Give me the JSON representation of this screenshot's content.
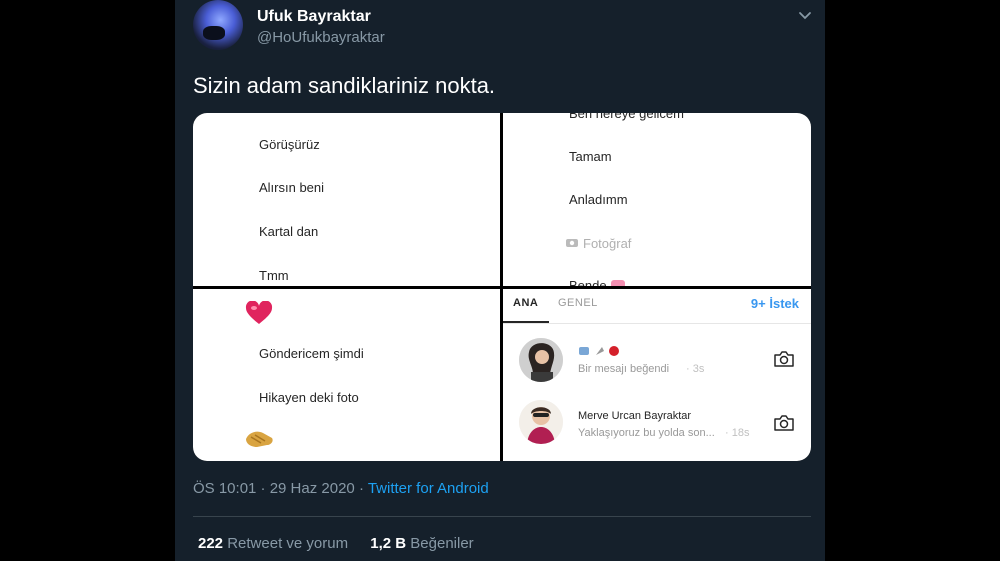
{
  "author": {
    "name": "Ufuk Bayraktar",
    "handle": "@HoUfukbayraktar"
  },
  "tweet": {
    "text": "Sizin adam sandiklariniz nokta."
  },
  "chat_left_top": {
    "messages": [
      "Görüşürüz",
      "Alırsın beni",
      "Kartal dan",
      "Tmm"
    ]
  },
  "chat_right_top": {
    "cut_top": "Ben nereye gelicem",
    "messages": [
      "Tamam",
      "Anladımm"
    ],
    "photo": "Fotoğraf",
    "cut_bottom": "Bende"
  },
  "chat_left_bottom": {
    "messages": [
      "Göndericem şimdi",
      "Hikayen deki foto"
    ]
  },
  "inbox": {
    "tabs": [
      "ANA",
      "GENEL"
    ],
    "requests": "9+ İstek",
    "threads": [
      {
        "subtitle": "Bir mesajı beğendi",
        "time": "· 3s"
      },
      {
        "title": "Merve Urcan Bayraktar",
        "subtitle": "Yaklaşıyoruz bu yolda son...",
        "time": "· 18s"
      }
    ]
  },
  "meta": {
    "time": "ÖS 10:01 · 29 Haz 2020 · ",
    "source": "Twitter for Android"
  },
  "stats": {
    "retweets_count": "222",
    "retweets_label": "Retweet ve yorum",
    "likes_count": "1,2 B",
    "likes_label": "Beğeniler"
  },
  "colors": {
    "background": "#15202b",
    "accent": "#1da1f2",
    "instagram_blue": "#3897f0"
  }
}
